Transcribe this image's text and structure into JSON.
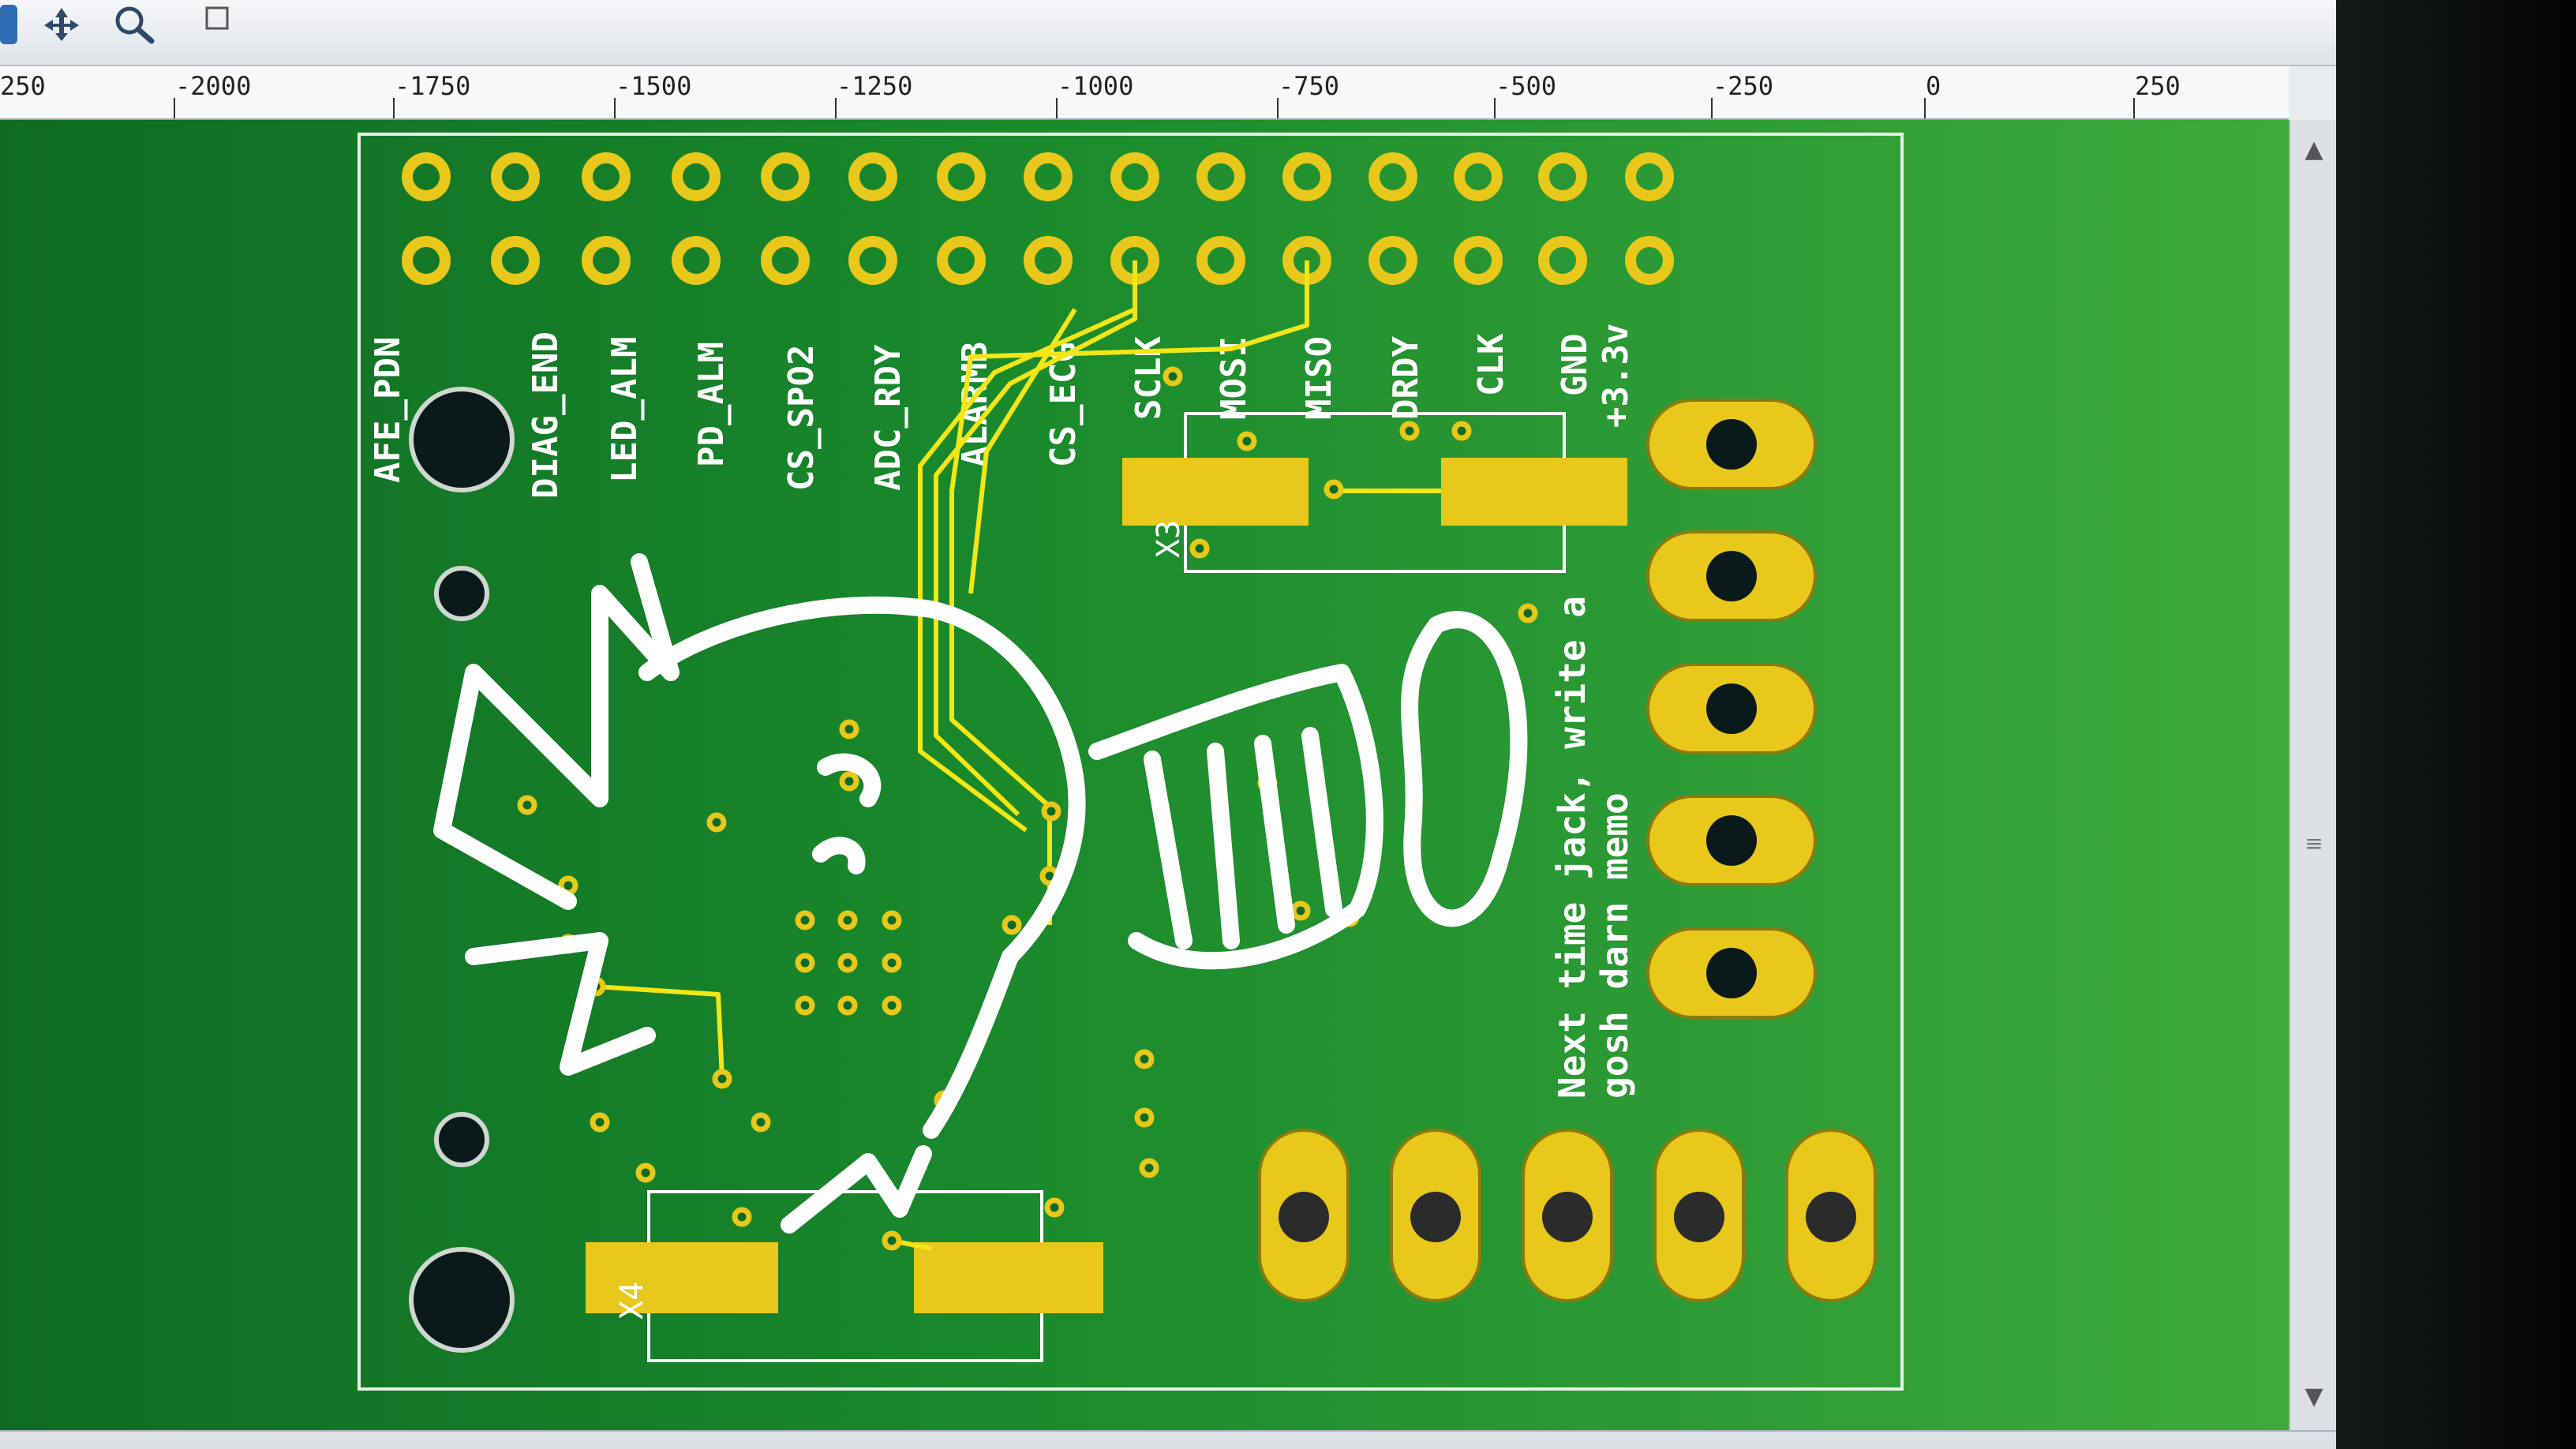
{
  "toolbar": {
    "icons": [
      "select-tool-icon",
      "move-icon",
      "zoom-icon",
      "grid-icon"
    ]
  },
  "ruler": {
    "labels": [
      "250",
      "-2000",
      "-1750",
      "-1500",
      "-1250",
      "-1000",
      "-750",
      "-500",
      "-250",
      "0",
      "250"
    ]
  },
  "board": {
    "header_labels": [
      "AFE_PDN",
      "DIAG_END",
      "LED_ALM",
      "PD_ALM",
      "CS_SPO2",
      "ADC_RDY",
      "ALARMB",
      "CS_ECG",
      "SCLK",
      "MOSI",
      "MISO",
      "DRDY",
      "CLK",
      "GND",
      "+3.3v"
    ],
    "component_labels": [
      "X3",
      "X4"
    ],
    "silkscreen_text": [
      "Next time jack, write a",
      "gosh darn memo"
    ]
  },
  "colors": {
    "board_green": "#1a8a2c",
    "pad_gold": "#e8c81a",
    "trace_yellow": "#f2e616",
    "silkscreen_white": "#ffffff"
  }
}
